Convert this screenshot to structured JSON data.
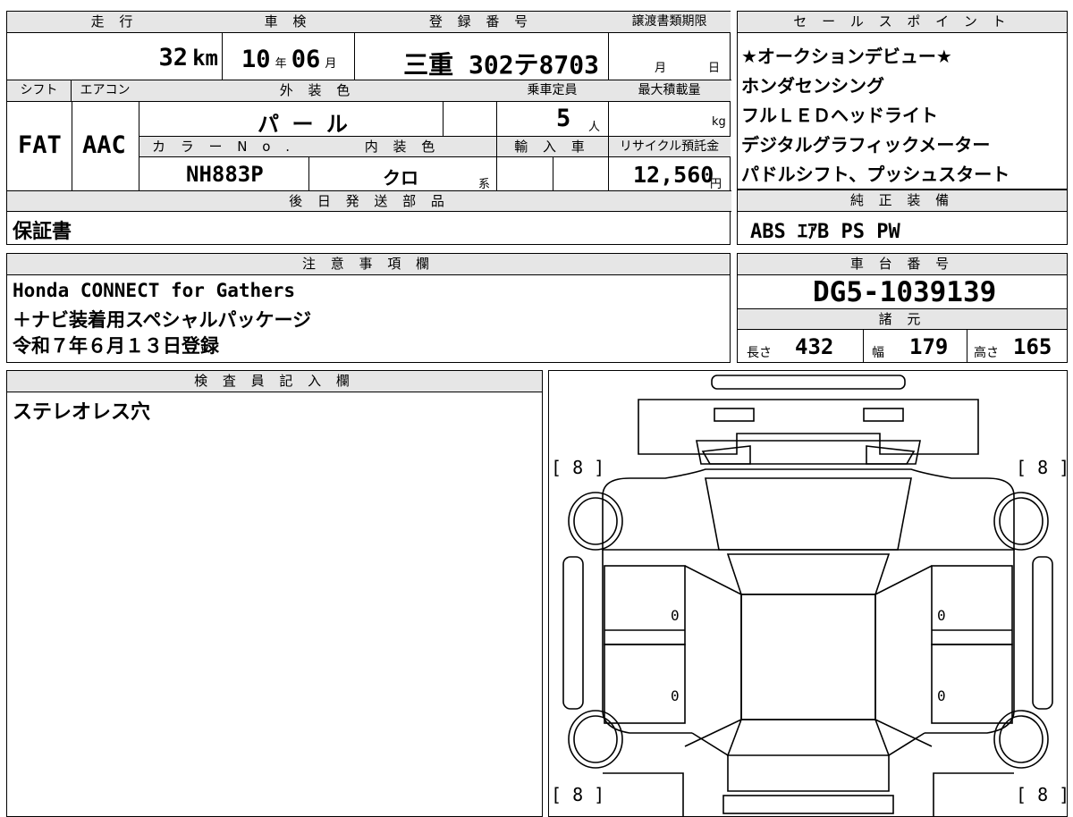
{
  "top": {
    "headers": {
      "mileage": "走 行",
      "inspection": "車 検",
      "registration": "登 録 番 号",
      "deadline": "譲渡書類期限",
      "shift": "シフト",
      "aircon": "エアコン",
      "exterior_color": "外 装 色",
      "capacity": "乗車定員",
      "max_load": "最大積載量",
      "color_no": "カ ラ ー N o .",
      "interior_color": "内 装 色",
      "import": "輸 入 車",
      "recycle": "リサイクル預託金",
      "later_parts": "後 日 発 送 部 品"
    },
    "mileage_value": "32",
    "mileage_unit": "km",
    "inspection_year": "10",
    "inspection_year_unit": "年",
    "inspection_month": "06",
    "inspection_month_unit": "月",
    "registration_value": "三重 302テ8703",
    "deadline_month_unit": "月",
    "deadline_day_unit": "日",
    "shift_value": "FAT",
    "aircon_value": "AAC",
    "exterior_value": "パ ー ル",
    "capacity_value": "5",
    "capacity_unit": "人",
    "max_load_unit": "kg",
    "color_no_value": "NH883P",
    "interior_value": "クロ",
    "interior_suffix": "系",
    "recycle_value": "12,560",
    "recycle_unit": "円",
    "later_parts_value": "保証書"
  },
  "sales_points": {
    "header": "セ ー ル ス ポ イ ン ト",
    "items": [
      "★オークションデビュー★",
      "ホンダセンシング",
      "フルＬＥＤヘッドライト",
      "デジタルグラフィックメーター",
      "パドルシフト、プッシュスタート"
    ]
  },
  "genuine_equipment": {
    "header": "純 正 装 備",
    "value": "ABS ｴｱB PS PW"
  },
  "notes": {
    "header": "注 意 事 項 欄",
    "lines": [
      "Honda CONNECT for Gathers",
      "＋ナビ装着用スペシャルパッケージ",
      "令和７年６月１３日登録"
    ]
  },
  "chassis": {
    "header": "車 台 番 号",
    "value": "DG5-1039139"
  },
  "specs": {
    "header": "諸 元",
    "length_label": "長さ",
    "length_value": "432",
    "width_label": "幅",
    "width_value": "179",
    "height_label": "高さ",
    "height_value": "165"
  },
  "inspector": {
    "header": "検 査 員 記 入 欄",
    "value": "ステレオレス穴"
  },
  "diagram": {
    "tire_front_left": "[ 8 ]",
    "tire_front_right": "[ 8 ]",
    "tire_rear_left": "[ 8 ]",
    "tire_rear_right": "[ 8 ]",
    "door_marks": [
      "0",
      "0",
      "0",
      "0"
    ]
  }
}
